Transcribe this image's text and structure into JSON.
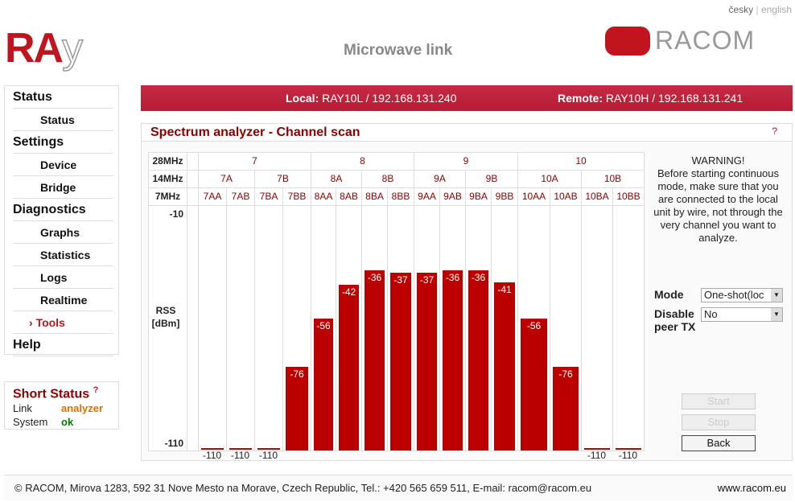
{
  "lang": {
    "cz": "česky",
    "sep": "|",
    "en": "english"
  },
  "header": {
    "logo_left": "RAy",
    "title": "Microwave link",
    "logo_right": "RACOM"
  },
  "sidebar": [
    {
      "label": "Status",
      "level": "h"
    },
    {
      "label": "Status",
      "level": "s"
    },
    {
      "label": "Settings",
      "level": "h"
    },
    {
      "label": "Device",
      "level": "s"
    },
    {
      "label": "Bridge",
      "level": "s"
    },
    {
      "label": "Diagnostics",
      "level": "h"
    },
    {
      "label": "Graphs",
      "level": "s"
    },
    {
      "label": "Statistics",
      "level": "s"
    },
    {
      "label": "Logs",
      "level": "s"
    },
    {
      "label": "Realtime",
      "level": "s"
    },
    {
      "label": "Tools",
      "level": "s",
      "active": true
    },
    {
      "label": "Help",
      "level": "h"
    }
  ],
  "short_status": {
    "title": "Short Status",
    "help": "?",
    "rows": [
      {
        "k": "Link",
        "v": "analyzer",
        "color": "#e07000"
      },
      {
        "k": "System",
        "v": "ok",
        "color": "#008000"
      }
    ]
  },
  "infobar": {
    "local_label": "Local:",
    "local": "RAY10L / 192.168.131.240",
    "remote_label": "Remote:",
    "remote": "RAY10H / 192.168.131.241"
  },
  "panel": {
    "title": "Spectrum analyzer - Channel scan",
    "help": "?"
  },
  "chart_data": {
    "type": "bar",
    "row_labels": [
      "28MHz",
      "14MHz",
      "7MHz"
    ],
    "ch28": [
      "7",
      "8",
      "9",
      "10"
    ],
    "ch14": [
      "7A",
      "7B",
      "8A",
      "8B",
      "9A",
      "9B",
      "10A",
      "10B"
    ],
    "categories": [
      "7AA",
      "7AB",
      "7BA",
      "7BB",
      "8AA",
      "8AB",
      "8BA",
      "8BB",
      "9AA",
      "9AB",
      "9BA",
      "9BB",
      "10AA",
      "10AB",
      "10BA",
      "10BB"
    ],
    "values": [
      -110,
      -110,
      -110,
      -76,
      -56,
      -42,
      -36,
      -37,
      -37,
      -36,
      -36,
      -41,
      -56,
      -76,
      -110,
      -110
    ],
    "ylim": [
      -110,
      -10
    ],
    "ytick_top": "-10",
    "ytick_bottom": "-110",
    "ylabel": "RSS",
    "yunit": "[dBm]",
    "color": "#bb0000"
  },
  "warning": [
    "WARNING!",
    "Before starting continuous mode, make sure that you are connected to the local unit by wire, not through the very channel you want to analyze."
  ],
  "form": {
    "mode_label": "Mode",
    "mode_value": "One-shot(loc",
    "disable_label": "Disable peer TX",
    "disable_value": "No"
  },
  "buttons": {
    "start": "Start",
    "stop": "Stop",
    "back": "Back"
  },
  "footer": {
    "text": "© RACOM, Mirova 1283, 592 31 Nove Mesto na Morave, Czech Republic, Tel.: +420 565 659 511, E-mail: racom@racom.eu",
    "link": "www.racom.eu"
  }
}
